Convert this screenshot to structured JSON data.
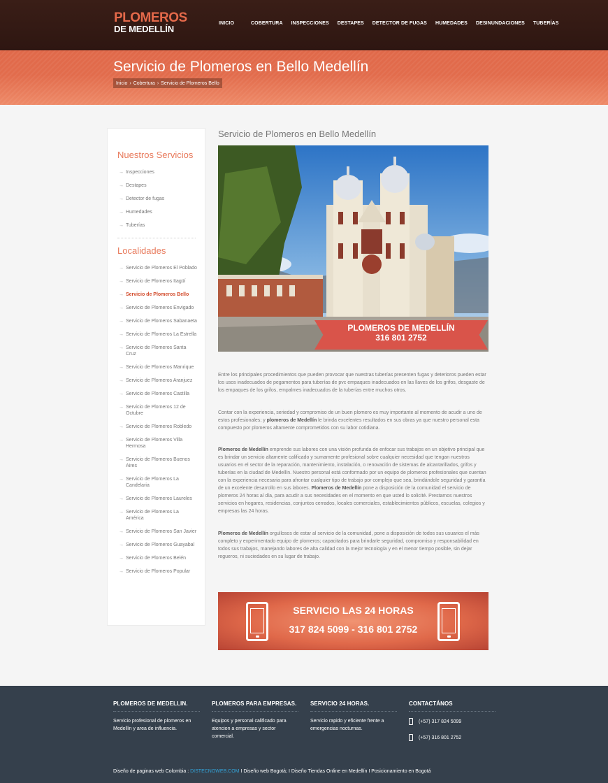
{
  "header": {
    "logo_line1": "PLOMEROS",
    "logo_line2": "DE MEDELLÍN",
    "nav": [
      "INICIO",
      "COBERTURA",
      "INSPECCIONES",
      "DESTAPES",
      "DETECTOR DE FUGAS",
      "HUMEDADES",
      "DESINUNDACIONES",
      "TUBERÍAS"
    ]
  },
  "band": {
    "title": "Servicio de Plomeros en Bello Medellín",
    "breadcrumbs": [
      "Inicio",
      "Cobertura",
      "Servicio de Plomeros Bello"
    ],
    "separator": "›"
  },
  "sidebar": {
    "services_title": "Nuestros Servicios",
    "services": [
      "Inspecciones",
      "Destapes",
      "Detector de fugas",
      "Humedades",
      "Tuberías"
    ],
    "localities_title": "Localidades",
    "localities": [
      "Servicio de Plomeros El Poblado",
      "Servicio de Plomeros Itagüí",
      "Servicio de Plomeros Bello",
      "Servicio de Plomeros Envigado",
      "Servicio de Plomeros Sabanaeta",
      "Servicio de Plomeros La Estrella",
      "Servicio de Plomeros Santa Cruz",
      "Servicio de Plomeros Manrique",
      "Servicio de Plomeros Aranjuez",
      "Servicio de Plomeros Castilla",
      "Servicio de Plomeros 12 de Octubre",
      "Servicio de Plomeros Robledo",
      "Servicio de Plomeros Villa Hermosa",
      "Servicio de Plomeros Buenos Aires",
      "Servicio de Plomeros La Candelaria",
      "Servicio de Plomeros Laureles",
      "Servicio de Plomeros La América",
      "Servicio de Plomeros San Javier",
      "Servicio de Plomeros Guayabal",
      "Servicio de Plomeros Belén",
      "Servicio de Plomeros Popular"
    ]
  },
  "main": {
    "title": "Servicio de Plomeros en Bello Medellín",
    "promo_line1": "PLOMEROS DE MEDELLÍN",
    "promo_line2": "316 801 2752",
    "p1": "Entre los principales procedimientos que pueden provocar que nuestras tuberías presenten fugas y deterioros pueden estar los usos inadecuados de pegamentos para tuberías de pvc empaques inadecuados en las llaves de los grifos, desgaste de los empaques de los grifos, empalmes inadecuados de la tuberías entre muchos otros.",
    "p2_a": "Contar con la experiencia, seriedad y compromiso de un buen plomero es muy importante al momento de acudir a uno de estos profesionales; y ",
    "p2_b": "plomeros de Medellín",
    "p2_c": " le brinda excelentes resultados en sus obras ya que nuestro personal esta compuesto por plomeros altamente comprometidos con su labor cotidiana.",
    "p3_a": "Plomeros de Medellín",
    "p3_b": " emprende sus labores con una visión profunda de enfocar sus trabajos en un objetivo principal que es brindar un servicio altamente calificado y sumamente profesional sobre cualquier necesidad que tengan nuestros usuarios en el sector de la reparación, mantenimiento, instalación, o renovación de sistemas de alcantarillados, grifos y tuberías en la ciudad de Medellín. Nuestro personal está conformado por un equipo de plomeros profesionales que cuentan con la experiencia necesaria para afrontar cualquier tipo de trabajo por complejo que sea, brindándole seguridad y garantía de un excelente desarrollo en sus labores. ",
    "p3_c": "Plomeros de Medellín",
    "p3_d": " pone a disposición de la comunidad el servicio de plomeros 24 horas al día, para acudir a sus necesidades en el momento en que usted lo solicité. Prestamos nuestros servicios en hogares, residencias, conjuntos cerrados, locales comerciales, establecimientos públicos, escuelas, colegios y empresas las 24 horas.",
    "p4_a": "Plomeros de Medellín",
    "p4_b": " orgullosos de estar al servicio de la comunidad, pone a disposición de todos sus usuarios el más completo y experimentado equipo de plomeros; capacitados para brindarle seguridad, compromiso y responsabilidad en todos sus trabajos, manejando labores de alta calidad con la mejor tecnología y en el menor tiempo posible, sin dejar regueros, ni suciedades en su lugar de trabajo.",
    "service_line1": "SERVICIO LAS 24 HORAS",
    "service_line2": "317 824 5099 - 316 801 2752"
  },
  "footer": {
    "col1_title": "PLOMEROS DE MEDELLIN.",
    "col1_text": "Servicio profesional de plomeros en Medellín y area de influencia.",
    "col2_title": "PLOMEROS PARA EMPRESAS.",
    "col2_text": "Equipos y personal calificado para atencion a empresas y sector comercial.",
    "col3_title": "SERVICIO 24 HORAS.",
    "col3_text": "Servicio rapido y eficiente frente a emergencias nocturnas.",
    "col4_title": "CONTACTÁNOS",
    "phones": [
      "(+57) 317 824 5099",
      "(+57) 316 801 2752"
    ],
    "copy_a": "Diseño de paginas web Colombia : ",
    "copy_link": "DISTECNOWEB.COM",
    "copy_b": " I Diseño web Bogotá; I Diseño Tiendas Online en Medellín I Posicionamiento en Bogotá"
  }
}
